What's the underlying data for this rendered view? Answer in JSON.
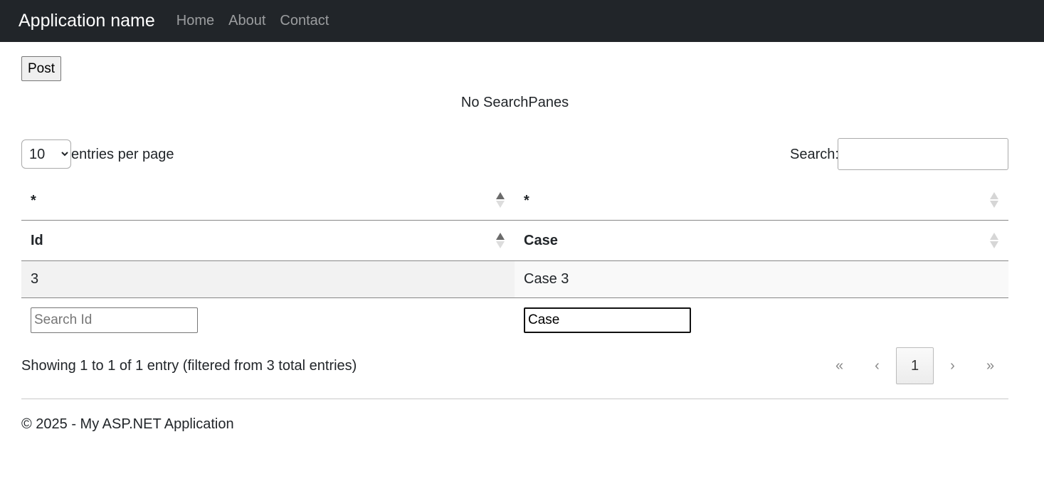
{
  "nav": {
    "brand": "Application name",
    "links": [
      "Home",
      "About",
      "Contact"
    ]
  },
  "toolbar": {
    "post_label": "Post"
  },
  "search_panes_message": "No SearchPanes",
  "length_menu": {
    "selected": "10",
    "label": "entries per page"
  },
  "search": {
    "label": "Search:",
    "value": ""
  },
  "table": {
    "group_headers": [
      "*",
      "*"
    ],
    "columns": [
      "Id",
      "Case"
    ],
    "rows": [
      [
        "3",
        "Case 3"
      ]
    ],
    "filters": [
      {
        "placeholder": "Search Id",
        "value": ""
      },
      {
        "placeholder": "",
        "value": "Case"
      }
    ],
    "sort": {
      "column": "Id",
      "direction": "ascending"
    }
  },
  "info": "Showing 1 to 1 of 1 entry (filtered from 3 total entries)",
  "pagination": {
    "first": "«",
    "prev": "‹",
    "current": "1",
    "next": "›",
    "last": "»"
  },
  "footer": "© 2025 - My ASP.NET Application"
}
